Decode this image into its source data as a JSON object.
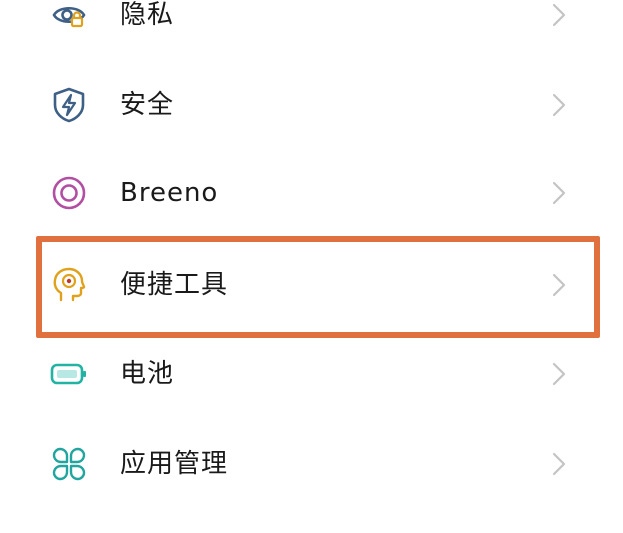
{
  "settings": {
    "items": [
      {
        "label": "隐私",
        "icon": "privacy-eye-lock-icon",
        "color": "#3E5F86"
      },
      {
        "label": "安全",
        "icon": "security-shield-bolt-icon",
        "color": "#3E5F86"
      },
      {
        "label": "Breeno",
        "icon": "breeno-ring-icon",
        "color": "#B24FA3"
      },
      {
        "label": "便捷工具",
        "icon": "head-gear-tools-icon",
        "color": "#E0A21C"
      },
      {
        "label": "电池",
        "icon": "battery-icon",
        "color": "#22B3A5"
      },
      {
        "label": "应用管理",
        "icon": "app-grid-icon",
        "color": "#22A59E"
      }
    ],
    "chevron_icon": "chevron-right-icon",
    "highlight_color": "#E0703E",
    "highlighted_item": "便捷工具"
  }
}
